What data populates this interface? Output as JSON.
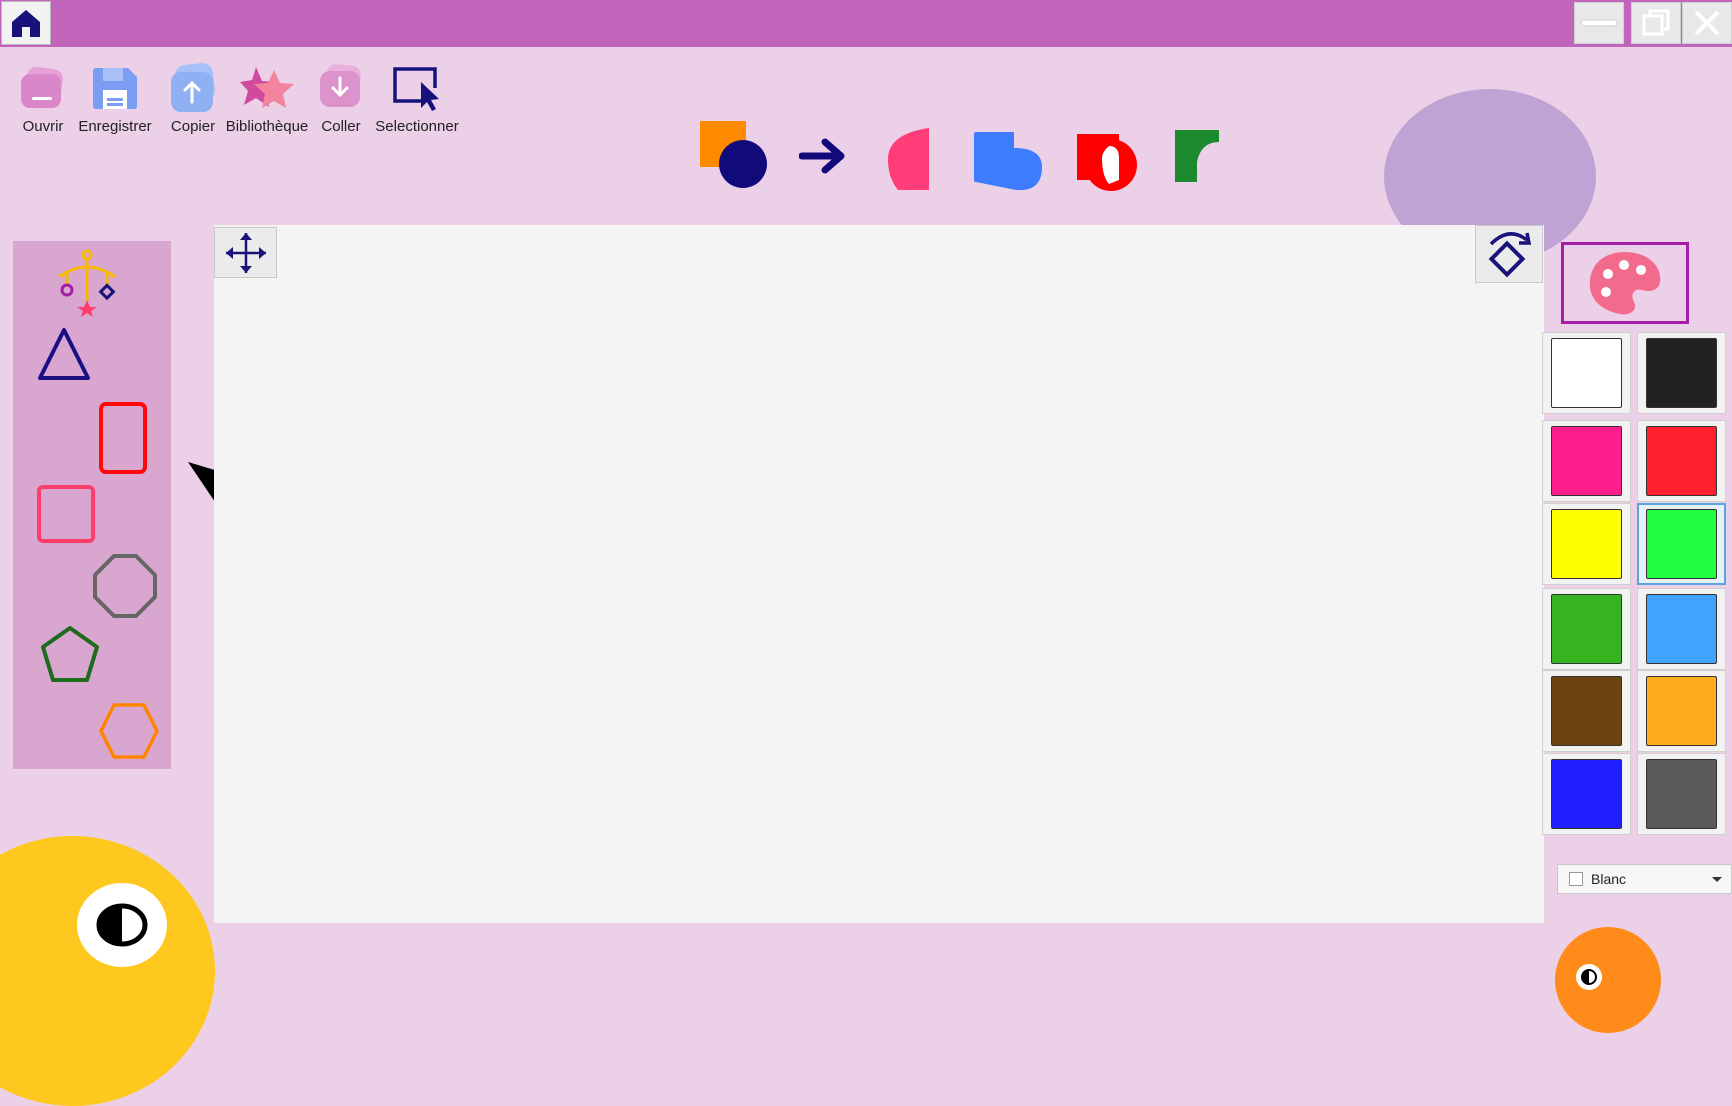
{
  "toolbar": {
    "open_label": "Ouvrir",
    "save_label": "Enregistrer",
    "copy_label": "Copier",
    "library_label": "Bibliothèque",
    "paste_label": "Coller",
    "select_label": "Selectionner"
  },
  "shape_tools": [
    {
      "icon": "square-circle-union-icon",
      "colors": [
        "#ff8a00",
        "#100a7a"
      ]
    },
    {
      "icon": "arrow-right-icon",
      "colors": [
        "#120a7a"
      ]
    },
    {
      "icon": "half-circle-icon",
      "colors": [
        "#ff3d78"
      ]
    },
    {
      "icon": "square-circle-merge-icon",
      "colors": [
        "#3d7cff"
      ]
    },
    {
      "icon": "square-circle-difference-icon",
      "colors": [
        "#ff0000",
        "#ffffff"
      ]
    },
    {
      "icon": "square-circle-subtract-icon",
      "colors": [
        "#1a8a2c"
      ]
    }
  ],
  "shapes_panel": [
    {
      "icon": "mobile-shapes-icon"
    },
    {
      "icon": "triangle-icon",
      "color": "#1a0f80"
    },
    {
      "icon": "rectangle-icon",
      "color": "#ff0a0a"
    },
    {
      "icon": "square-icon",
      "color": "#ff3d6b"
    },
    {
      "icon": "octagon-icon",
      "color": "#666666"
    },
    {
      "icon": "pentagon-icon",
      "color": "#1e6b1e"
    },
    {
      "icon": "hexagon-icon",
      "color": "#ff8500"
    }
  ],
  "colors": [
    {
      "name": "white",
      "hex": "#ffffff"
    },
    {
      "name": "black",
      "hex": "#222222"
    },
    {
      "name": "pink",
      "hex": "#ff1f8c"
    },
    {
      "name": "red",
      "hex": "#ff1f2e"
    },
    {
      "name": "yellow",
      "hex": "#ffff00"
    },
    {
      "name": "bright-green",
      "hex": "#1fff3f",
      "selected": true
    },
    {
      "name": "green",
      "hex": "#35b41f"
    },
    {
      "name": "light-blue",
      "hex": "#3fa3ff"
    },
    {
      "name": "brown",
      "hex": "#6b4412"
    },
    {
      "name": "orange",
      "hex": "#ffac1f"
    },
    {
      "name": "blue",
      "hex": "#1f1fff"
    },
    {
      "name": "gray",
      "hex": "#5a5a5a"
    }
  ],
  "color_select": {
    "value": "Blanc"
  },
  "theme": {
    "titlebar": "#c165bc",
    "background": "#ecd0e8",
    "canvas": "#f4f4f4",
    "accent": "#a41fa6"
  }
}
